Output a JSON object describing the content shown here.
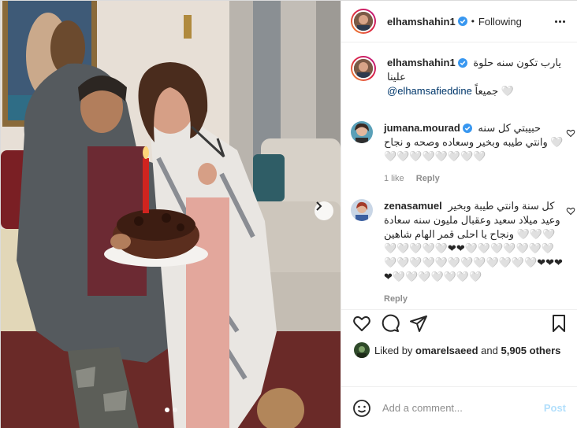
{
  "post": {
    "username": "elhamshahin1",
    "following_label": "Following",
    "separator": "•",
    "more_label": "More options"
  },
  "caption": {
    "username": "elhamshahin1",
    "text": "يارب تكون سنه حلوة علينا",
    "mention": "@elhamsafieddine",
    "text_end": "جميعاً 🤍"
  },
  "comments": [
    {
      "username": "jumana.mourad",
      "text": "حبيبتي كل سنه وانتي طيبه وبخير وسعاده وصحه و نجاح 🤍🤍🤍🤍🤍🤍🤍🤍🤍",
      "likes": "1 like",
      "reply": "Reply"
    },
    {
      "username": "zenasamuel",
      "text": "كل سنة وانتي طيبة وبخير وعيد ميلاد سعيد وعقبال مليون سنه سعادة ونجاح يا احلى قمر الهام شاهين 🤍🤍🤍🤍🤍🤍🤍🤍❤❤🤍🤍🤍🤍🤍🤍🤍🤍🤍🤍🤍🤍🤍🤍🤍🤍🤍🤍🤍❤❤❤❤🤍🤍🤍🤍🤍🤍🤍",
      "reply": "Reply"
    }
  ],
  "likes": {
    "prefix": "Liked by",
    "liker": "omarelsaeed",
    "and": "and",
    "others": "5,905 others"
  },
  "add_comment": {
    "placeholder": "Add a comment...",
    "post_label": "Post"
  },
  "carousel": {
    "count": 2,
    "active_index": 0
  },
  "colors": {
    "verified_blue": "#3897f0",
    "link_blue": "#00376b",
    "post_disabled": "#b2dffc",
    "muted_text": "#8e8e8e"
  },
  "icons": [
    "verified-badge-icon",
    "more-options-icon",
    "heart-icon",
    "comment-icon",
    "share-icon",
    "bookmark-icon",
    "emoji-icon",
    "chevron-right-icon"
  ]
}
